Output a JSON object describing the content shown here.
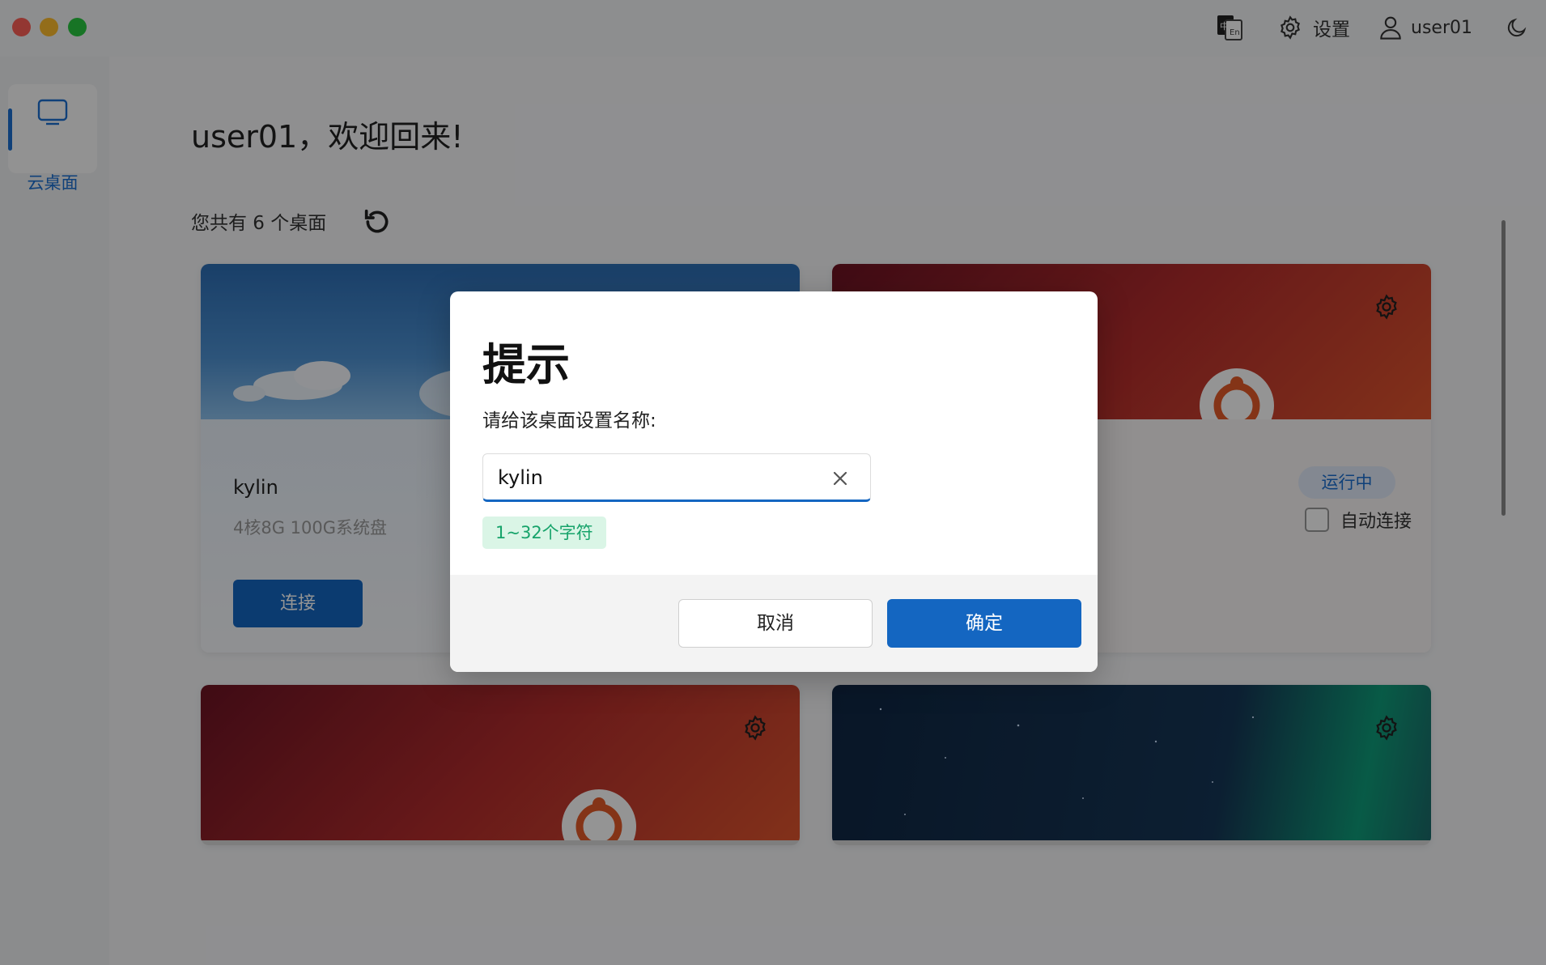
{
  "titlebar": {
    "settings_label": "设置",
    "username": "user01",
    "icons": [
      "language-toggle-icon",
      "gear-icon",
      "user-icon",
      "moon-icon"
    ]
  },
  "sidebar": {
    "items": [
      {
        "label": "云桌面",
        "icon": "monitor-icon",
        "active": true
      }
    ]
  },
  "main": {
    "welcome": "user01，欢迎回来!",
    "desktop_count_text": "您共有 6 个桌面",
    "cards": [
      {
        "name": "kylin",
        "spec": "4核8G 100G系统盘",
        "button": "连接",
        "background": "sky"
      },
      {
        "status": "运行中",
        "auto_connect_label": "自动连接",
        "background": "ubuntu"
      },
      {
        "background": "ubuntu"
      },
      {
        "background": "aurora"
      }
    ]
  },
  "dialog": {
    "title": "提示",
    "message": "请给该桌面设置名称:",
    "input_value": "kylin",
    "hint": "1~32个字符",
    "cancel_label": "取消",
    "ok_label": "确定"
  },
  "colors": {
    "accent": "#1466c1",
    "hint_bg": "#daf5e6",
    "hint_text": "#16a36a",
    "overlay": "rgba(0,0,0,0.42)"
  }
}
